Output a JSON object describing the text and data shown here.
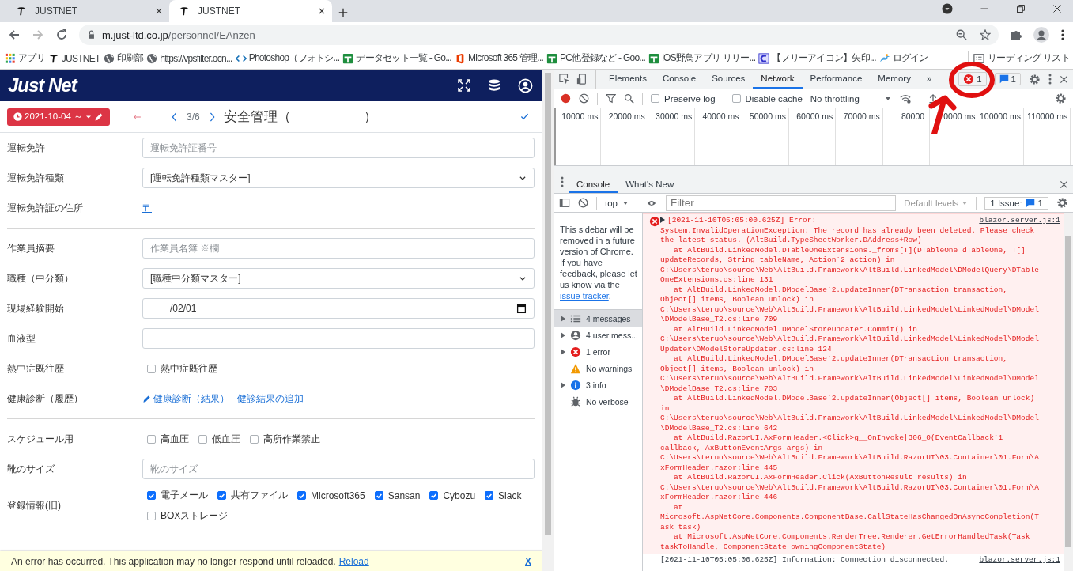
{
  "browser": {
    "tabs": [
      {
        "title": "JUSTNET",
        "selected": false
      },
      {
        "title": "JUSTNET",
        "selected": true
      }
    ],
    "address": {
      "host": "m.just-ltd.co.jp",
      "path": "/personnel/EAnzen"
    },
    "bookmarks": [
      {
        "label": "アプリ",
        "kind": "apps"
      },
      {
        "label": "JUSTNET",
        "kind": "logo"
      },
      {
        "label": "印刷部",
        "kind": "globe"
      },
      {
        "label": "https://vpsfilter.ocn...",
        "kind": "globe"
      },
      {
        "label": "Photoshop（フォトシ...",
        "kind": "code"
      },
      {
        "label": "データセット一覧 - Go...",
        "kind": "sheet"
      },
      {
        "label": "Microsoft 365 管理...",
        "kind": "office"
      },
      {
        "label": "PC他登録など - Goo...",
        "kind": "sheet"
      },
      {
        "label": "iOS野鳥アプリ リリー...",
        "kind": "sheet"
      },
      {
        "label": "【フリーアイコン】矢印...",
        "kind": "letter"
      },
      {
        "label": "ログイン",
        "kind": "bird"
      }
    ],
    "reading_list": "リーディング リスト"
  },
  "app": {
    "logo": "Just Net",
    "date_button": "2021-10-04 ～",
    "page": "3/6",
    "title": "安全管理（",
    "title_close": "）",
    "rows": [
      {
        "kind": "input",
        "label": "運転免許",
        "placeholder": "運転免許証番号"
      },
      {
        "kind": "select",
        "label": "運転免許種類",
        "value": "[運転免許種類マスター]"
      },
      {
        "kind": "links",
        "label": "運転免許証の住所",
        "links": [
          {
            "text": "〒",
            "edit": false
          }
        ]
      },
      {
        "kind": "divider"
      },
      {
        "kind": "input",
        "label": "作業員摘要",
        "placeholder": "作業員名簿 ※欄"
      },
      {
        "kind": "select",
        "label": "職種（中分類）",
        "value": "[職種中分類マスター]"
      },
      {
        "kind": "date",
        "label": "現場経験開始",
        "value": "/02/01"
      },
      {
        "kind": "input",
        "label": "血液型"
      },
      {
        "kind": "checks",
        "label": "熱中症既往歴",
        "options": [
          {
            "label": "熱中症既往歴",
            "checked": false
          }
        ]
      },
      {
        "kind": "links",
        "label": "健康診断（履歴）",
        "links": [
          {
            "text": "健康診断（結果）",
            "edit": true
          },
          {
            "text": "健診結果の追加",
            "edit": false
          }
        ]
      },
      {
        "kind": "divider"
      },
      {
        "kind": "checks",
        "label": "スケジュール用",
        "options": [
          {
            "label": "高血圧",
            "checked": false
          },
          {
            "label": "低血圧",
            "checked": false
          },
          {
            "label": "高所作業禁止",
            "checked": false
          }
        ]
      },
      {
        "kind": "input",
        "label": "靴のサイズ",
        "placeholder": "靴のサイズ"
      },
      {
        "kind": "checks",
        "label": "登録情報(旧)",
        "options": [
          {
            "label": "電子メール",
            "checked": true
          },
          {
            "label": "共有ファイル",
            "checked": true
          },
          {
            "label": "Microsoft365",
            "checked": true
          },
          {
            "label": "Sansan",
            "checked": true
          },
          {
            "label": "Cybozu",
            "checked": true
          },
          {
            "label": "Slack",
            "checked": true
          },
          {
            "label": "BOXストレージ",
            "checked": false
          }
        ]
      }
    ],
    "banner": {
      "message": "An error has occurred. This application may no longer respond until reloaded.",
      "link": "Reload",
      "close": "X"
    }
  },
  "devtools": {
    "tabs": [
      {
        "label": "Elements",
        "selected": false
      },
      {
        "label": "Console",
        "selected": false
      },
      {
        "label": "Sources",
        "selected": false
      },
      {
        "label": "Network",
        "selected": true
      },
      {
        "label": "Performance",
        "selected": false
      },
      {
        "label": "Memory",
        "selected": false
      }
    ],
    "more": "»",
    "error_count": "1",
    "info_count": "1",
    "network": {
      "preserve_log": {
        "label": "Preserve log",
        "checked": false
      },
      "disable_cache": {
        "label": "Disable cache",
        "checked": false
      },
      "throttling": "No throttling",
      "ticks": [
        "10000 ms",
        "20000 ms",
        "30000 ms",
        "40000 ms",
        "50000 ms",
        "60000 ms",
        "70000 ms",
        "80000",
        "0000 ms",
        "100000 ms",
        "110000 ms"
      ]
    },
    "drawer_tabs": [
      {
        "label": "Console",
        "selected": true
      },
      {
        "label": "What's New",
        "selected": false
      }
    ],
    "console": {
      "context": "top",
      "filter_placeholder": "Filter",
      "levels": "Default levels",
      "issues": "1 Issue:",
      "issue_count": "1",
      "note": "This sidebar will be removed in a future version of Chrome. If you have feedback, please let us know via the",
      "note_link": "issue tracker",
      "note_end": ".",
      "sidebar": [
        {
          "kind": "messages",
          "label": "4 messages",
          "expandable": true,
          "selected": true
        },
        {
          "kind": "user",
          "label": "4 user mess...",
          "expandable": true,
          "selected": false
        },
        {
          "kind": "error",
          "label": "1 error",
          "expandable": true,
          "selected": false
        },
        {
          "kind": "warning",
          "label": "No warnings",
          "expandable": false,
          "selected": false
        },
        {
          "kind": "info",
          "label": "3 info",
          "expandable": true,
          "selected": false
        },
        {
          "kind": "verbose",
          "label": "No verbose",
          "expandable": false,
          "selected": false
        }
      ],
      "messages": [
        {
          "kind": "error",
          "header": "[2021-11-10T05:05:00.625Z] Error:",
          "source": "blazor.server.js:1",
          "lines": [
            "System.InvalidOperationException: The record has already been deleted. Please check",
            "the latest status. (AltBuild.TypeSheetWorker.DAddress+Row)",
            "   at AltBuild.LinkedModel.DTableOneExtensions._froms[T](DTableOne dTableOne, T[]",
            "updateRecords, String tableName, Action`2 action) in",
            "C:\\Users\\teruo\\source\\Web\\AltBuild.Framework\\AltBuild.LinkedModel\\DModelQuery\\DTable",
            "OneExtensions.cs:line 131",
            "   at AltBuild.LinkedModel.DModelBase`2.updateInner(DTransaction transaction,",
            "Object[] items, Boolean unlock) in",
            "C:\\Users\\teruo\\source\\Web\\AltBuild.Framework\\AltBuild.LinkedModel\\LinkedModel\\DModel",
            "\\DModelBase_T2.cs:line 709",
            "   at AltBuild.LinkedModel.DModelStoreUpdater.Commit() in",
            "C:\\Users\\teruo\\source\\Web\\AltBuild.Framework\\AltBuild.LinkedModel\\LinkedModel\\DModel",
            "Updater\\DModelStoreUpdater.cs:line 124",
            "   at AltBuild.LinkedModel.DModelBase`2.updateInner(DTransaction transaction,",
            "Object[] items, Boolean unlock) in",
            "C:\\Users\\teruo\\source\\Web\\AltBuild.Framework\\AltBuild.LinkedModel\\LinkedModel\\DModel",
            "\\DModelBase_T2.cs:line 703",
            "   at AltBuild.LinkedModel.DModelBase`2.updateInner(Object[] items, Boolean unlock)",
            "in",
            "C:\\Users\\teruo\\source\\Web\\AltBuild.Framework\\AltBuild.LinkedModel\\LinkedModel\\DModel",
            "\\DModelBase_T2.cs:line 642",
            "   at AltBuild.RazorUI.AxFormHeader.<Click>g__OnInvoke|306_0(EventCallback`1",
            "callback, AxButtonEventArgs args) in",
            "C:\\Users\\teruo\\source\\Web\\AltBuild.Framework\\AltBuild.RazorUI\\03.Container\\01.Form\\A",
            "xFormHeader.razor:line 445",
            "   at AltBuild.RazorUI.AxFormHeader.Click(AxButtonResult results) in",
            "C:\\Users\\teruo\\source\\Web\\AltBuild.Framework\\AltBuild.RazorUI\\03.Container\\01.Form\\A",
            "xFormHeader.razor:line 446",
            "   at",
            "Microsoft.AspNetCore.Components.ComponentBase.CallStateHasChangedOnAsyncCompletion(T",
            "ask task)",
            "   at Microsoft.AspNetCore.Components.RenderTree.Renderer.GetErrorHandledTask(Task",
            "taskToHandle, ComponentState owningComponentState)"
          ]
        },
        {
          "kind": "info",
          "header": "[2021-11-10T05:05:00.625Z] Information: Connection disconnected.",
          "source": "blazor.server.js:1"
        }
      ]
    }
  },
  "annotation": {
    "kind": "circle-arrow"
  }
}
